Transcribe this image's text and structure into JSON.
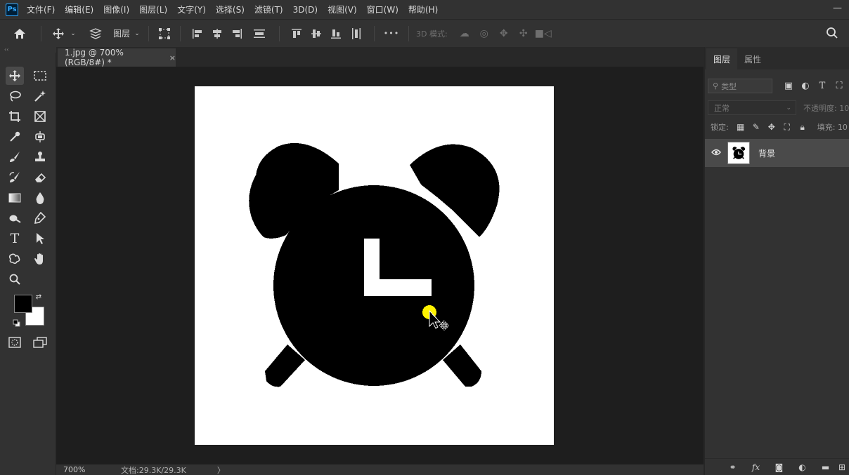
{
  "app": {
    "logo": "Ps",
    "window_control": "—"
  },
  "menu": [
    "文件(F)",
    "编辑(E)",
    "图像(I)",
    "图层(L)",
    "文字(Y)",
    "选择(S)",
    "滤镜(T)",
    "3D(D)",
    "视图(V)",
    "窗口(W)",
    "帮助(H)"
  ],
  "options": {
    "auto_select_target": "图层",
    "mode_3d_label": "3D 模式:",
    "more_label": "•••"
  },
  "document": {
    "tab_title": "1.jpg @ 700%(RGB/8#) *",
    "close_glyph": "×"
  },
  "status": {
    "zoom": "700%",
    "doc_size": "文档:29.3K/29.3K",
    "arrow": "〉"
  },
  "panel": {
    "tabs": [
      "图层",
      "属性"
    ],
    "filter_placeholder": "类型",
    "blend_mode": "正常",
    "opacity_label": "不透明度: 10",
    "lock_label": "锁定:",
    "fill_label": "填充: 10",
    "layer_name": "背景"
  },
  "colors": {
    "foreground": "#000000",
    "background": "#ffffff",
    "cursor_highlight": "#fff200",
    "accent": "#31a8ff"
  },
  "icons": {
    "home": "home-icon",
    "move": "move-icon",
    "search": "search-icon",
    "eye": "eye-icon"
  }
}
